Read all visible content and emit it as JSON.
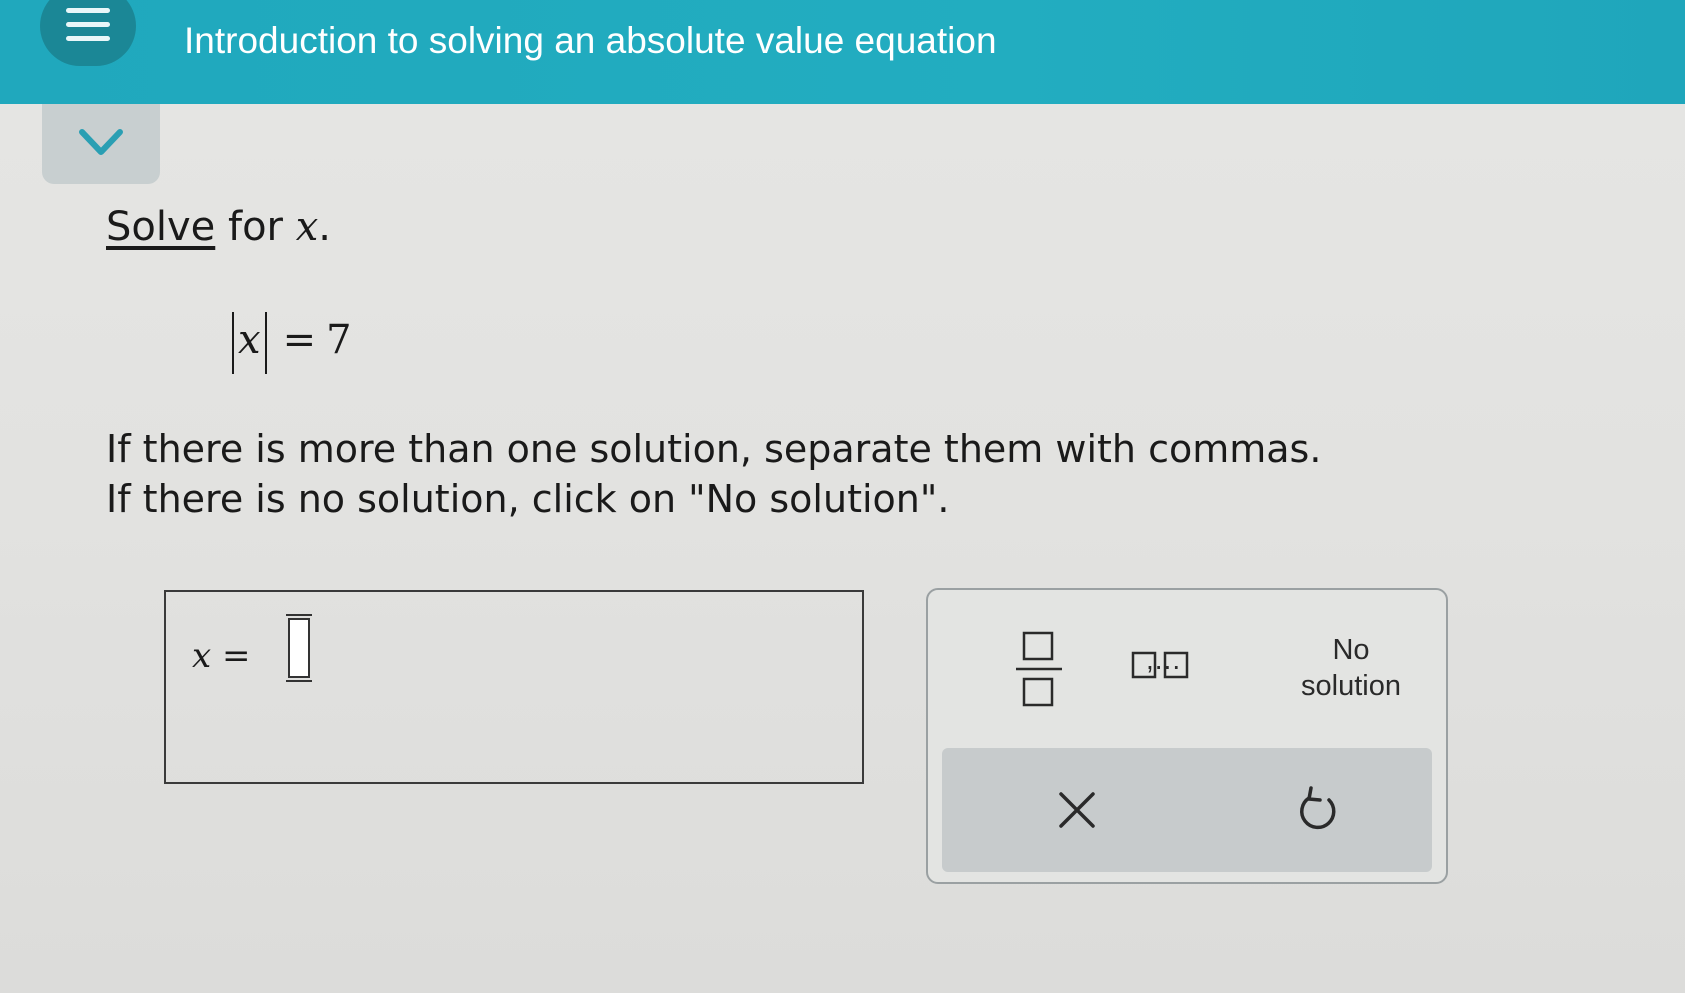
{
  "header": {
    "topic_title": "Introduction to solving an absolute value equation",
    "menu_icon": "hamburger-menu-icon",
    "collapse_icon": "chevron-down-icon",
    "background_color": "#20a8bd"
  },
  "problem": {
    "solve_link": "Solve",
    "solve_rest": " for ",
    "variable": "x",
    "period": ".",
    "equation": {
      "inner": "x",
      "operator": "=",
      "rhs": "7"
    },
    "instruction_line1": "If there is more than one solution, separate them with commas.",
    "instruction_line2": "If there is no solution, click on \"No solution\"."
  },
  "answer": {
    "label": "x =",
    "value": ""
  },
  "keypad": {
    "fraction_icon": "fraction-template-icon",
    "list_icon": "comma-list-template-icon",
    "list_ellipsis": ",...",
    "no_solution_line1": "No",
    "no_solution_line2": "solution",
    "clear_icon": "clear-x-icon",
    "undo_icon": "undo-arrow-icon"
  }
}
